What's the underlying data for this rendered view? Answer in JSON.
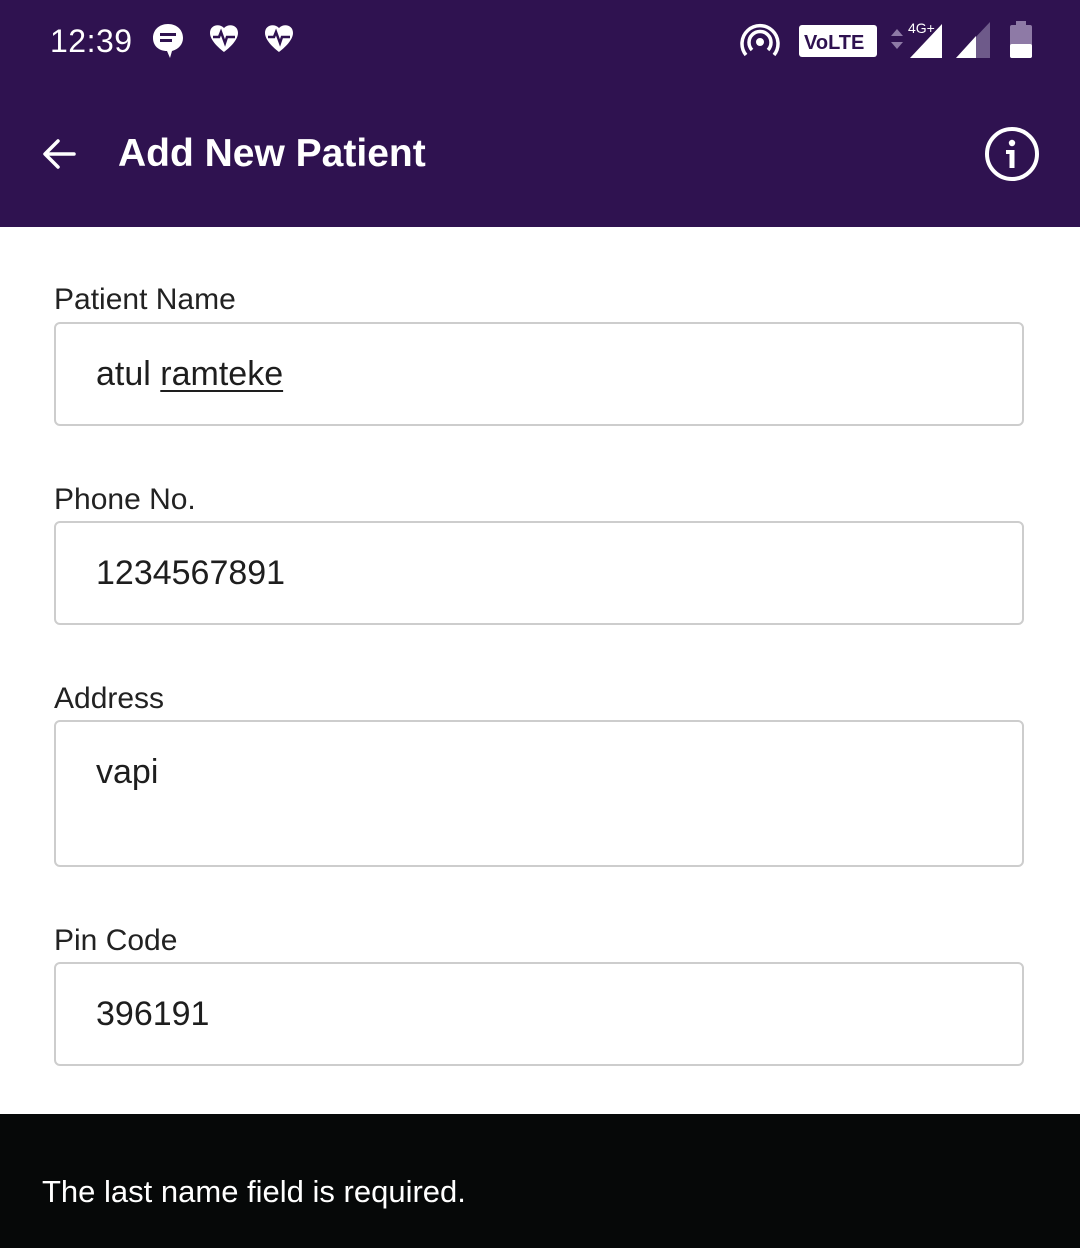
{
  "status_bar": {
    "time": "12:39",
    "volte_label": "VoLTE",
    "network_label": "4G+",
    "notification_icons": [
      "chat-bubble-icon",
      "heartbeat-icon",
      "heartbeat-icon"
    ],
    "system_icons": [
      "hotspot-icon",
      "volte-icon",
      "signal-4g-icon",
      "signal-icon",
      "battery-icon"
    ]
  },
  "app_bar": {
    "title": "Add New Patient",
    "back_icon": "arrow-left-icon",
    "info_icon": "info-icon"
  },
  "form": {
    "patient_name": {
      "label": "Patient Name",
      "value_first": "atul",
      "value_second": "ramteke"
    },
    "phone": {
      "label": "Phone No.",
      "value": "1234567891"
    },
    "address": {
      "label": "Address",
      "value": "vapi"
    },
    "pin_code": {
      "label": "Pin Code",
      "value": "396191"
    }
  },
  "snackbar": {
    "message": "The last name field is required."
  },
  "colors": {
    "primary": "#2f1250",
    "snackbar_bg": "#060808",
    "field_border": "#cdcdcd",
    "text": "#1e1e1e"
  }
}
